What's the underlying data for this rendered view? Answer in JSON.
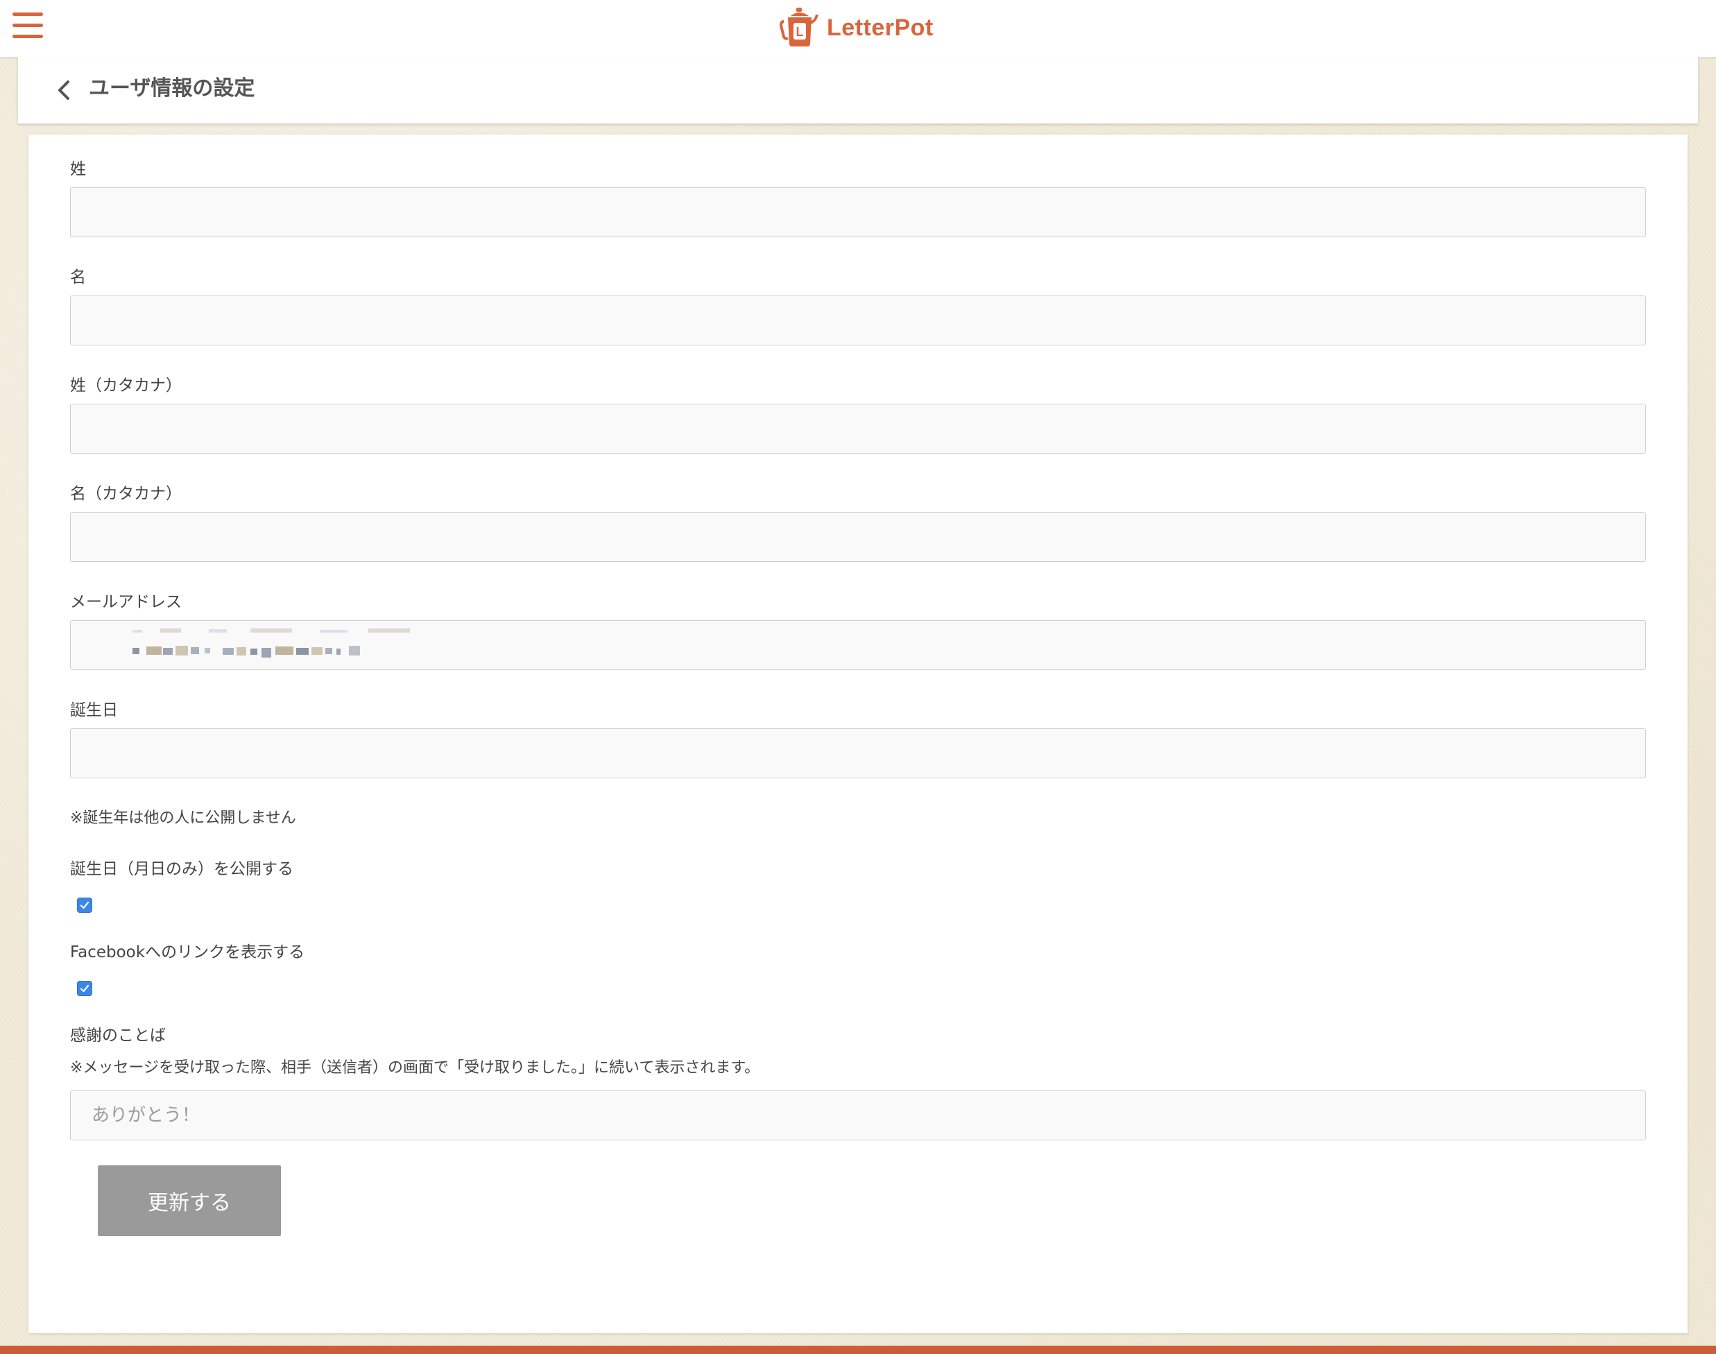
{
  "app": {
    "name": "LetterPot",
    "logo_letter": "L",
    "brand_color": "#d9653d"
  },
  "header": {
    "menu_icon": "hamburger-menu-icon",
    "back_icon": "chevron-left-icon",
    "title": "ユーザ情報の設定"
  },
  "form": {
    "last_name": {
      "label": "姓",
      "value": ""
    },
    "first_name": {
      "label": "名",
      "value": ""
    },
    "last_name_kana": {
      "label": "姓（カタカナ）",
      "value": ""
    },
    "first_name_kana": {
      "label": "名（カタカナ）",
      "value": ""
    },
    "email": {
      "label": "メールアドレス",
      "value": ""
    },
    "birthday": {
      "label": "誕生日",
      "value": ""
    },
    "birthday_note": "※誕生年は他の人に公開しません",
    "publish_birthday": {
      "label": "誕生日（月日のみ）を公開する",
      "checked": true
    },
    "facebook_link": {
      "label": "Facebookへのリンクを表示する",
      "checked": true
    },
    "thanks_message": {
      "label": "感謝のことば",
      "note": "※メッセージを受け取った際、相手（送信者）の画面で「受け取りました。」に続いて表示されます。",
      "placeholder": "ありがとう！",
      "value": ""
    },
    "submit_label": "更新する"
  }
}
